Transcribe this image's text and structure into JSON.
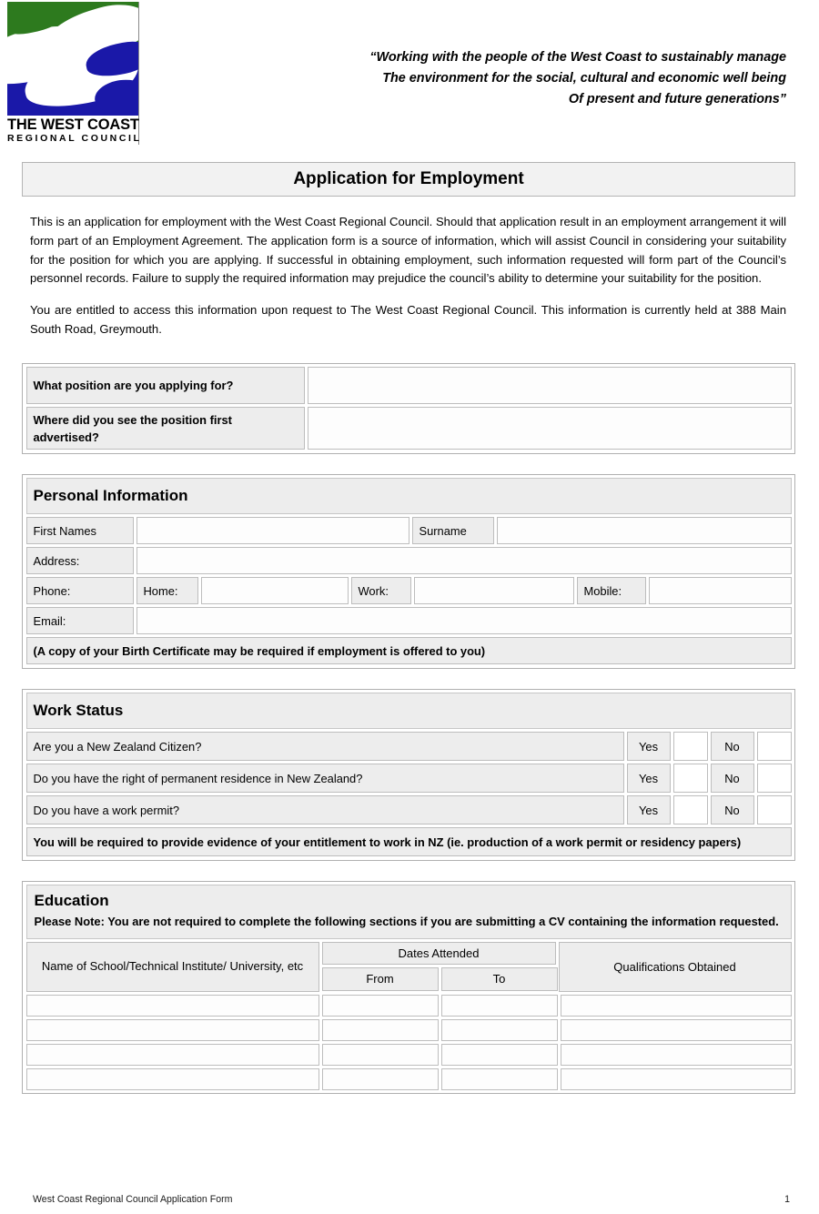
{
  "logo": {
    "line1": "THE WEST COAST",
    "line2": "REGIONAL COUNCIL",
    "green": "#2d7a1e",
    "blue": "#1a18a8"
  },
  "tagline": {
    "line1": "“Working with the people of the West Coast to sustainably manage",
    "line2": "The environment for the social, cultural and economic well being",
    "line3": "Of present and future generations”"
  },
  "title": "Application for Employment",
  "intro": {
    "paragraph1": "This is an application for employment with the West Coast Regional Council.  Should that application result in an employment arrangement it will form part of an Employment Agreement.  The application form is a source of information, which will assist Council in considering your suitability for the position for which you are applying.  If successful in obtaining employment, such information requested will form part of the Council’s personnel records.  Failure to supply the required information may prejudice the council’s ability to determine your suitability for the position.",
    "paragraph2": "You are entitled to access this information upon request to The West Coast Regional Council.  This information is currently held at 388 Main South Road, Greymouth."
  },
  "position": {
    "question1_label": "What position are you applying for?",
    "question1_value": "",
    "question2_label": "Where did you see the position first advertised?",
    "question2_value": ""
  },
  "personal": {
    "heading": "Personal Information",
    "first_names_label": "First Names",
    "first_names_value": "",
    "surname_label": "Surname",
    "surname_value": "",
    "address_label": "Address:",
    "address_value": "",
    "phone_label": "Phone:",
    "home_label": "Home:",
    "home_value": "",
    "work_label": "Work:",
    "work_value": "",
    "mobile_label": "Mobile:",
    "mobile_value": "",
    "email_label": "Email:",
    "email_value": "",
    "note": "(A copy of your Birth Certificate may be required if employment is offered to you)"
  },
  "work_status": {
    "heading": "Work Status",
    "yes_label": "Yes",
    "no_label": "No",
    "questions": [
      "Are you a New Zealand Citizen?",
      "Do you have the right of permanent residence in New Zealand?",
      "Do you have a work permit?"
    ],
    "note": "You will be required to provide evidence of your entitlement to work in NZ (ie. production of a work permit or residency papers)"
  },
  "education": {
    "heading": "Education",
    "note": "Please Note: You are not required to complete the following sections if you are submitting a CV containing the information requested.",
    "columns": {
      "name": "Name of School/Technical Institute/ University, etc",
      "dates_attended": "Dates Attended",
      "from": "From",
      "to": "To",
      "qualifications": "Qualifications Obtained"
    },
    "rows": [
      {
        "name": "",
        "from": "",
        "to": "",
        "qualifications": ""
      },
      {
        "name": "",
        "from": "",
        "to": "",
        "qualifications": ""
      },
      {
        "name": "",
        "from": "",
        "to": "",
        "qualifications": ""
      },
      {
        "name": "",
        "from": "",
        "to": "",
        "qualifications": ""
      }
    ]
  },
  "footer": {
    "text": "West Coast Regional Council Application Form",
    "page": "1"
  }
}
